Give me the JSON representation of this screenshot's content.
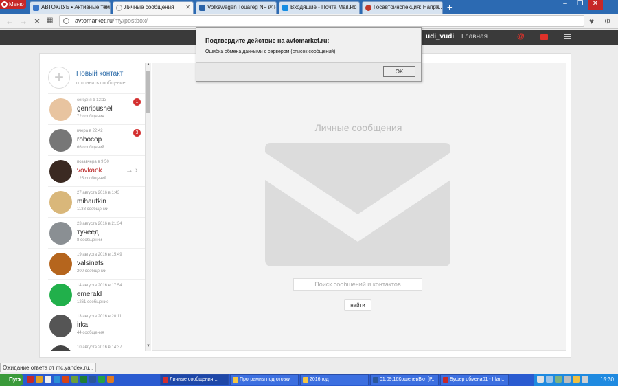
{
  "browser": {
    "menu_label": "Меню",
    "tabs": [
      {
        "label": "АВТОКЛУБ • Активные темы",
        "color": "#3a77c9"
      },
      {
        "label": "Личные сообщения",
        "color": "#9e9e9e"
      },
      {
        "label": "Volkswagen Touareg NF и Touareg",
        "color": "#2a63a8"
      },
      {
        "label": "Входящие - Почта Mail.Ru",
        "color": "#168de2"
      },
      {
        "label": "Госавтоинспекция: Напра...",
        "color": "#c0392b"
      }
    ],
    "url_host": "avtomarket.ru",
    "url_path": "/my/postbox/"
  },
  "site_header": {
    "username": "udi_vudi",
    "home_label": "Главная",
    "at_symbol": "@"
  },
  "contacts": {
    "new_contact_label": "Новый контакт",
    "new_contact_sub": "отправить сообщение",
    "items": [
      {
        "date": "сегодня в 12:13",
        "name": "genripushel",
        "count": "72 сообщения",
        "badge": "1",
        "avatar_color": "#e8c4a0"
      },
      {
        "date": "вчера в 22:42",
        "name": "robocop",
        "count": "66 сообщений",
        "badge": "3",
        "avatar_color": "#777777"
      },
      {
        "date": "позавчера в 9:50",
        "name": "vovkaok",
        "count": "125 сообщений",
        "badge": "",
        "avatar_color": "#3b2a22"
      },
      {
        "date": "27 августа 2016 в 1:43",
        "name": "mihautkin",
        "count": "1138 сообщений",
        "badge": "",
        "avatar_color": "#d9b77a"
      },
      {
        "date": "23 августа 2016 в 21:34",
        "name": "тучеед",
        "count": "8 сообщений",
        "badge": "",
        "avatar_color": "#8a8f93"
      },
      {
        "date": "19 августа 2016 в 15:49",
        "name": "valsinats",
        "count": "200 сообщений",
        "badge": "",
        "avatar_color": "#b5651d"
      },
      {
        "date": "14 августа 2016 в 17:54",
        "name": "emerald",
        "count": "1261 сообщение",
        "badge": "",
        "avatar_color": "#21b04b"
      },
      {
        "date": "13 августа 2016 в 20:11",
        "name": "irka",
        "count": "44 сообщения",
        "badge": "",
        "avatar_color": "#555555"
      },
      {
        "date": "10 августа 2016 в 14:37",
        "name": "",
        "count": "",
        "badge": "",
        "avatar_color": "#444444"
      }
    ]
  },
  "messages": {
    "title": "Личные сообщения",
    "search_placeholder": "Поиск сообщений и контактов",
    "find_button": "найти"
  },
  "dialog": {
    "title": "Подтвердите действие на avtomarket.ru:",
    "message": "Ошибка обмена данными с сервером (список сообщений)",
    "ok_label": "OK"
  },
  "status_bar": "Ожидание ответа от mc.yandex.ru...",
  "taskbar": {
    "start_label": "Пуск",
    "tasks": [
      {
        "label": "Личные сообщения ...",
        "color": "#d32f2f"
      },
      {
        "label": "Програмны подготовки",
        "color": "#f4c542"
      },
      {
        "label": "2016 год",
        "color": "#f4c542"
      },
      {
        "label": "01.09.16КошелевВкл [P...",
        "color": "#2b579a"
      },
      {
        "label": "Буфер обмена01 - Irfan...",
        "color": "#c62828"
      }
    ],
    "time": "15:30"
  }
}
